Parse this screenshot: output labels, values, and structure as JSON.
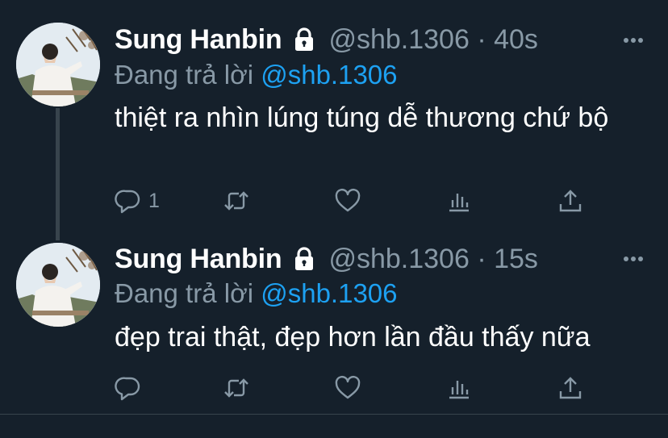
{
  "colors": {
    "background": "#15202b",
    "text_primary": "#ffffff",
    "text_secondary": "#8899a6",
    "mention": "#1da1f2",
    "divider": "#38444d"
  },
  "icons": [
    "lock-icon",
    "more-icon",
    "reply-icon",
    "retweet-icon",
    "like-icon",
    "analytics-icon",
    "share-icon"
  ],
  "tweets": [
    {
      "author": "Sung Hanbin",
      "handle_time": "@shb.1306 · 40s",
      "reply_prefix": "Đang trả lời",
      "reply_to": "@shb.1306",
      "text": "thiệt ra nhìn lúng túng dễ thương chứ bộ",
      "reply_count": "1"
    },
    {
      "author": "Sung Hanbin",
      "handle_time": "@shb.1306 · 15s",
      "reply_prefix": "Đang trả lời",
      "reply_to": "@shb.1306",
      "text": "đẹp trai thật, đẹp hơn lần đầu thấy nữa",
      "reply_count": ""
    }
  ]
}
